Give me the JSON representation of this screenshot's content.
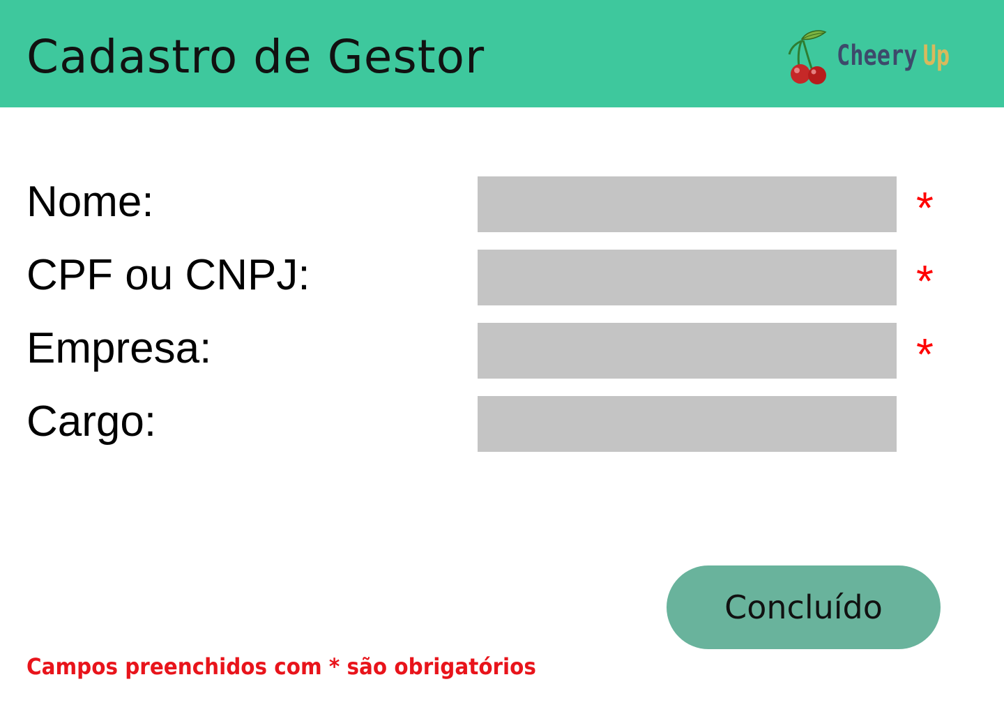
{
  "header": {
    "title": "Cadastro de Gestor",
    "logo": {
      "icon": "cherry-icon",
      "word1": "Cheery",
      "word2": "Up"
    }
  },
  "form": {
    "fields": [
      {
        "label": "Nome:",
        "value": "",
        "placeholder": "",
        "required": true,
        "required_mark": "*"
      },
      {
        "label": "CPF ou CNPJ:",
        "value": "",
        "placeholder": "",
        "required": true,
        "required_mark": "*"
      },
      {
        "label": "Empresa:",
        "value": "",
        "placeholder": "",
        "required": true,
        "required_mark": "*"
      },
      {
        "label": "Cargo:",
        "value": "",
        "placeholder": "",
        "required": false
      }
    ],
    "submit_label": "Concluído",
    "required_note": "Campos preenchidos com * são obrigatórios"
  },
  "colors": {
    "header_bg": "#3ec89d",
    "input_bg": "#c4c4c4",
    "button_bg": "#69b39c",
    "required": "#ff0000",
    "note": "#e8141b"
  }
}
